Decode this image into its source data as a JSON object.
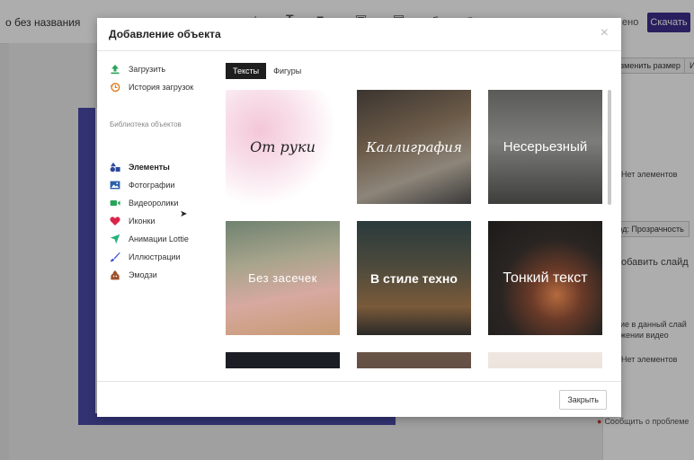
{
  "app": {
    "doc_title": "о без названия",
    "top_right_partial": "ено",
    "download_label": "Скачать",
    "right_panel": {
      "resize_button": "изменить размер",
      "extra_button": "И",
      "no_elements_1": "Нет элементов",
      "transparency_button": "ход: Прозрачность",
      "add_slide": "обавить слайд",
      "info_line1": "ние в данный слай",
      "info_line2": "ажении видео",
      "no_elements_2": "Нет элементов"
    },
    "report_link": "Сообщить о проблеме"
  },
  "modal": {
    "title": "Добавление объекта",
    "close_icon": "×",
    "sidebar": {
      "upload": "Загрузить",
      "history": "История загрузок",
      "library_header": "Библиотека объектов",
      "items": [
        {
          "label": "Элементы",
          "icon": "shapes-icon",
          "color": "#2c4a9a",
          "active": true
        },
        {
          "label": "Фотографии",
          "icon": "photo-icon",
          "color": "#2a5fa8",
          "active": false
        },
        {
          "label": "Видеоролики",
          "icon": "video-icon",
          "color": "#2aa35a",
          "active": false
        },
        {
          "label": "Иконки",
          "icon": "heart-icon",
          "color": "#d9254a",
          "active": false
        },
        {
          "label": "Анимации Lottie",
          "icon": "lottie-icon",
          "color": "#23b37a",
          "active": false
        },
        {
          "label": "Иллюстрации",
          "icon": "brush-icon",
          "color": "#3a4ed0",
          "active": false
        },
        {
          "label": "Эмодзи",
          "icon": "emoji-icon",
          "color": "#a0522d",
          "active": false
        }
      ]
    },
    "tabs": [
      {
        "label": "Тексты",
        "active": true
      },
      {
        "label": "Фигуры",
        "active": false
      }
    ],
    "cards": [
      {
        "label": "От руки"
      },
      {
        "label": "Каллиграфия"
      },
      {
        "label": "Несерьезный"
      },
      {
        "label": "Без засечек"
      },
      {
        "label": "В стиле техно"
      },
      {
        "label": "Тонкий текст"
      }
    ],
    "footer": {
      "close_label": "Закрыть"
    }
  }
}
